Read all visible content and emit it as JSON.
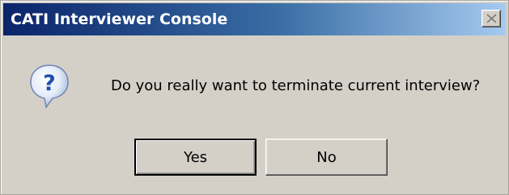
{
  "window": {
    "title": "CATI Interviewer Console",
    "close_icon": "close-icon"
  },
  "dialog": {
    "icon": "question-icon",
    "message": "Do you really want to terminate current interview?"
  },
  "buttons": {
    "yes_label": "Yes",
    "no_label": "No"
  },
  "colors": {
    "titlebar_start": "#0a246a",
    "titlebar_end": "#a6caf0",
    "dialog_bg": "#d4d0c8",
    "icon_blue": "#1f4fae"
  }
}
